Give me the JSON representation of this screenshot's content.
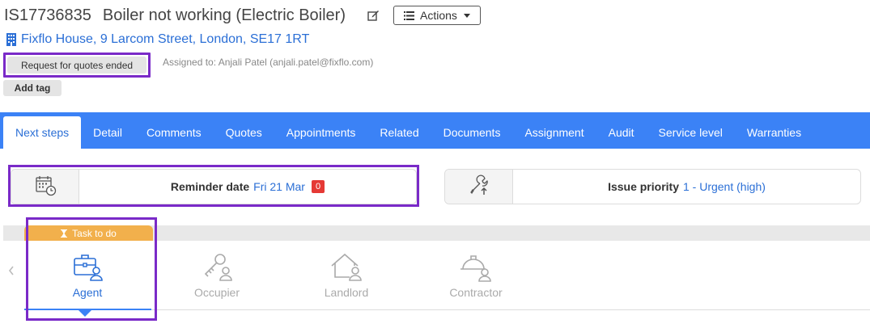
{
  "header": {
    "issue_ref": "IS17736835",
    "issue_title": "Boiler not working (Electric Boiler)",
    "actions_label": "Actions",
    "address": "Fixflo House, 9 Larcom Street, London, SE17 1RT"
  },
  "status": {
    "label": "Request for quotes ended",
    "assigned": "Assigned to: Anjali Patel (anjali.patel@fixflo.com)",
    "add_tag": "Add tag"
  },
  "tabs": [
    {
      "label": "Next steps",
      "active": true
    },
    {
      "label": "Detail"
    },
    {
      "label": "Comments"
    },
    {
      "label": "Quotes"
    },
    {
      "label": "Appointments"
    },
    {
      "label": "Related"
    },
    {
      "label": "Documents"
    },
    {
      "label": "Assignment"
    },
    {
      "label": "Audit"
    },
    {
      "label": "Service level"
    },
    {
      "label": "Warranties"
    }
  ],
  "reminder": {
    "label": "Reminder date",
    "value": "Fri 21 Mar",
    "badge": "0"
  },
  "priority": {
    "label": "Issue priority",
    "value": "1 - Urgent (high)"
  },
  "task": {
    "label": "Task to do"
  },
  "steps": [
    {
      "label": "Agent",
      "icon": "briefcase-person-icon",
      "active": true
    },
    {
      "label": "Occupier",
      "icon": "key-person-icon"
    },
    {
      "label": "Landlord",
      "icon": "house-person-icon"
    },
    {
      "label": "Contractor",
      "icon": "hardhat-person-icon"
    }
  ],
  "colors": {
    "accent": "#3b82f6",
    "link": "#2b6fd6",
    "highlight": "#7a2ac8",
    "task": "#f2b04c",
    "badge": "#e53935"
  }
}
